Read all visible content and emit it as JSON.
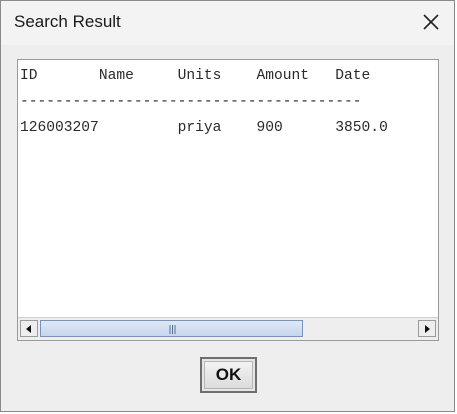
{
  "window": {
    "title": "Search Result",
    "close_icon": "close-icon"
  },
  "result_text": {
    "header": "ID       Name     Units    Amount   Date",
    "separator": "---------------------------------------",
    "row": "126003207         priya    900      3850.0"
  },
  "scrollbar": {
    "left_icon": "arrow-left-icon",
    "right_icon": "arrow-right-icon",
    "thumb_fraction": 0.7
  },
  "buttons": {
    "ok_label": "OK"
  }
}
